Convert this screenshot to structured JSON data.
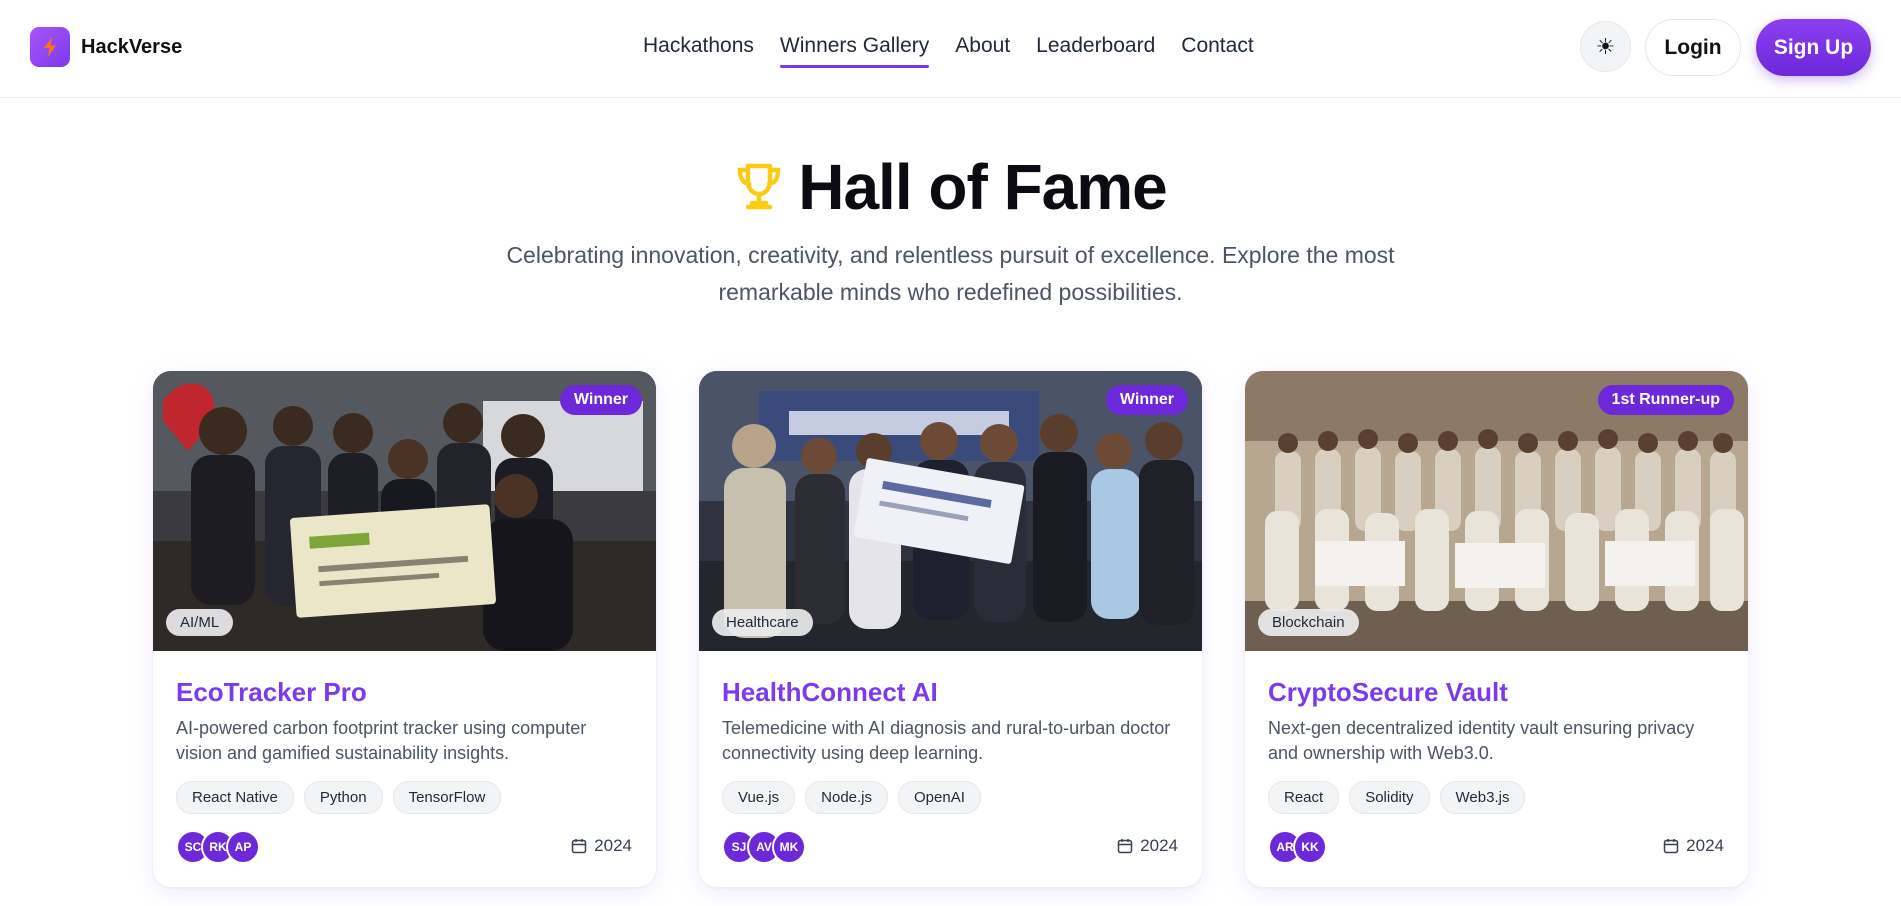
{
  "brand": {
    "name": "HackVerse",
    "logo_icon": "lightning-icon",
    "accent": "#7c3aed"
  },
  "nav": {
    "items": [
      {
        "label": "Hackathons",
        "active": false
      },
      {
        "label": "Winners Gallery",
        "active": true
      },
      {
        "label": "About",
        "active": false
      },
      {
        "label": "Leaderboard",
        "active": false
      },
      {
        "label": "Contact",
        "active": false
      }
    ]
  },
  "actions": {
    "theme_icon": "☀",
    "login_label": "Login",
    "signup_label": "Sign Up"
  },
  "hero": {
    "title": "Hall of Fame",
    "icon": "trophy-icon",
    "subtitle": "Celebrating innovation, creativity, and relentless pursuit of excellence. Explore the most remarkable minds who redefined possibilities."
  },
  "cards": [
    {
      "rank": "Winner",
      "category": "AI/ML",
      "title": "EcoTracker Pro",
      "description": "AI-powered carbon footprint tracker using computer vision and gamified sustainability insights.",
      "tags": [
        "React Native",
        "Python",
        "TensorFlow"
      ],
      "members": [
        "SC",
        "RK",
        "AP"
      ],
      "year": "2024"
    },
    {
      "rank": "Winner",
      "category": "Healthcare",
      "title": "HealthConnect AI",
      "description": "Telemedicine with AI diagnosis and rural-to-urban doctor connectivity using deep learning.",
      "tags": [
        "Vue.js",
        "Node.js",
        "OpenAI"
      ],
      "members": [
        "SJ",
        "AV",
        "MK"
      ],
      "year": "2024"
    },
    {
      "rank": "1st Runner-up",
      "category": "Blockchain",
      "title": "CryptoSecure Vault",
      "description": "Next-gen decentralized identity vault ensuring privacy and ownership with Web3.0.",
      "tags": [
        "React",
        "Solidity",
        "Web3.js"
      ],
      "members": [
        "AR",
        "KK"
      ],
      "year": "2024"
    }
  ]
}
